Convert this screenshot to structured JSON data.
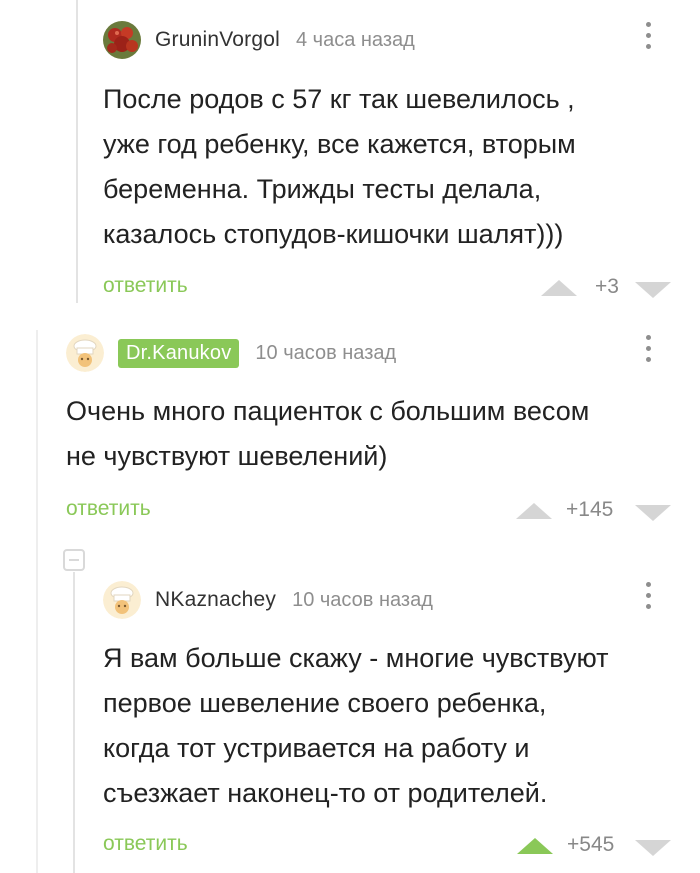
{
  "comments": [
    {
      "author": "GruninVorgol",
      "time": "4 часа назад",
      "lines": [
        "После родов с 57 кг так шевелилось ,",
        "уже год ребенку, все кажется, вторым",
        "беременна. Трижды тесты делала,",
        "казалось стопудов-кишочки шалят)))"
      ],
      "reply_label": "ответить",
      "score": "+3",
      "avatar_icon": "berries-avatar-icon"
    },
    {
      "author": "Dr.Kanukov",
      "time": "10 часов назад",
      "lines": [
        "Очень много пациенток с большим весом",
        "не чувствуют шевелений)"
      ],
      "reply_label": "ответить",
      "score": "+145",
      "avatar_icon": "chef-avatar-icon"
    },
    {
      "author": "NKaznachey",
      "time": "10 часов назад",
      "lines": [
        "Я вам больше скажу - многие чувствуют",
        "первое шевеление своего ребенка,",
        "когда тот устривается на работу и",
        "съезжает наконец-то от родителей."
      ],
      "reply_label": "ответить",
      "score": "+545",
      "avatar_icon": "chef-avatar-icon"
    }
  ],
  "colors": {
    "accent": "#8ac858",
    "muted": "#8e8e8e",
    "vote_inactive": "#d5d5d5"
  }
}
